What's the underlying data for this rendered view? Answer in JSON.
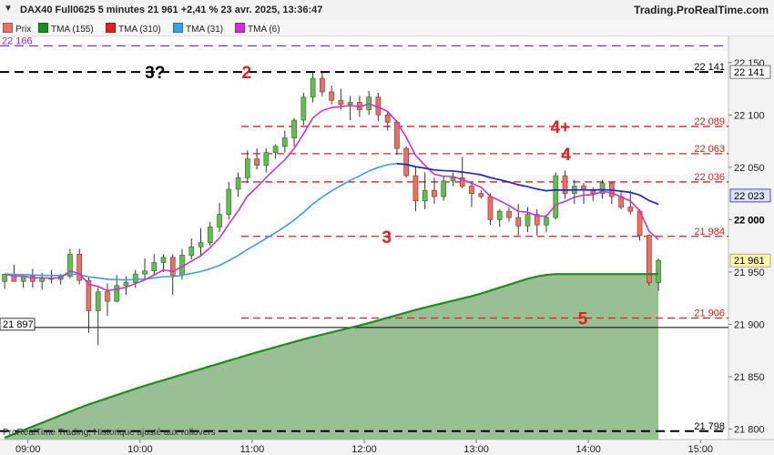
{
  "header": {
    "arrow_icon": "chevron-down",
    "title": "DAX40 Full0625 5 minutes 21 961 +2,41 % 23 avr. 2025, 13:36:47",
    "brand": "Trading.ProRealTime.com"
  },
  "legend": [
    {
      "label": "Prix",
      "color": "#e57366"
    },
    {
      "label": "TMA (155)",
      "color": "#1e8c1e"
    },
    {
      "label": "TMA (310)",
      "color": "#dd2020"
    },
    {
      "label": "TMA (31)",
      "color": "#3aa0e0"
    },
    {
      "label": "TMA (6)",
      "color": "#cc33cc"
    }
  ],
  "footer": "ProRealTime Trading, Historique ajusté aux rollovers",
  "chart_data": {
    "type": "candlestick",
    "y_range": [
      21790,
      22175
    ],
    "x_range": [
      "08:45",
      "15:15"
    ],
    "x_ticks": [
      "09:00",
      "10:00",
      "11:00",
      "12:00",
      "13:00",
      "14:00",
      "15:00"
    ],
    "y_ticks": [
      "22 150",
      "22 100",
      "22 050",
      "22 000",
      "21 950",
      "21 900",
      "21 850",
      "21 800"
    ],
    "colors": {
      "up": "#66bb55",
      "down": "#e57366",
      "up_border": "#2f7a25",
      "down_border": "#9a3a30",
      "tma155": "#1e8c1e",
      "tma31": "#3aa0e0",
      "tma6": "#cc33cc",
      "tma_blue": "#2222cc",
      "level": "#dd2020",
      "black_level": "#000000",
      "purple_level": "#8833cc",
      "area": "#8fb88a"
    },
    "candles": [
      [
        21941,
        21947,
        21934,
        21948
      ],
      [
        21948,
        21957,
        21941,
        21941
      ],
      [
        21941,
        21947,
        21935,
        21946
      ],
      [
        21946,
        21953,
        21935,
        21941
      ],
      [
        21941,
        21949,
        21933,
        21944
      ],
      [
        21944,
        21952,
        21939,
        21943
      ],
      [
        21943,
        21948,
        21938,
        21946
      ],
      [
        21946,
        21972,
        21944,
        21967
      ],
      [
        21967,
        21972,
        21938,
        21942
      ],
      [
        21942,
        21945,
        21892,
        21913
      ],
      [
        21913,
        21935,
        21880,
        21931
      ],
      [
        21931,
        21939,
        21908,
        21922
      ],
      [
        21922,
        21947,
        21921,
        21937
      ],
      [
        21937,
        21946,
        21928,
        21940
      ],
      [
        21940,
        21952,
        21935,
        21948
      ],
      [
        21948,
        21963,
        21942,
        21951
      ],
      [
        21951,
        21967,
        21947,
        21959
      ],
      [
        21959,
        21967,
        21950,
        21964
      ],
      [
        21964,
        21967,
        21928,
        21947
      ],
      [
        21947,
        21972,
        21943,
        21966
      ],
      [
        21966,
        21982,
        21962,
        21974
      ],
      [
        21974,
        21992,
        21966,
        21978
      ],
      [
        21978,
        21998,
        21975,
        21993
      ],
      [
        21993,
        22016,
        21988,
        22005
      ],
      [
        22005,
        22036,
        22000,
        22029
      ],
      [
        22029,
        22045,
        22022,
        22040
      ],
      [
        22040,
        22066,
        22035,
        22058
      ],
      [
        22058,
        22068,
        22048,
        22052
      ],
      [
        22052,
        22068,
        22045,
        22064
      ],
      [
        22064,
        22072,
        22058,
        22070
      ],
      [
        22070,
        22085,
        22064,
        22078
      ],
      [
        22078,
        22097,
        22070,
        22095
      ],
      [
        22095,
        22121,
        22090,
        22117
      ],
      [
        22117,
        22141,
        22112,
        22135
      ],
      [
        22135,
        22141,
        22118,
        22122
      ],
      [
        22122,
        22128,
        22110,
        22114
      ],
      [
        22114,
        22125,
        22105,
        22110
      ],
      [
        22110,
        22118,
        22095,
        22112
      ],
      [
        22112,
        22118,
        22098,
        22105
      ],
      [
        22105,
        22123,
        22100,
        22117
      ],
      [
        22117,
        22121,
        22094,
        22100
      ],
      [
        22100,
        22103,
        22085,
        22093
      ],
      [
        22093,
        22095,
        22062,
        22068
      ],
      [
        22068,
        22070,
        22040,
        22042
      ],
      [
        22042,
        22050,
        22008,
        22018
      ],
      [
        22018,
        22045,
        22010,
        22028
      ],
      [
        22028,
        22040,
        22015,
        22022
      ],
      [
        22022,
        22042,
        22018,
        22037
      ],
      [
        22037,
        22045,
        22032,
        22040
      ],
      [
        22040,
        22060,
        22030,
        22032
      ],
      [
        22032,
        22035,
        22012,
        22025
      ],
      [
        22025,
        22028,
        22020,
        22022
      ],
      [
        22022,
        22025,
        21995,
        22000
      ],
      [
        22000,
        22010,
        21993,
        22008
      ],
      [
        22008,
        22012,
        21998,
        22002
      ],
      [
        22002,
        22015,
        21985,
        21994
      ],
      [
        21994,
        22012,
        21988,
        22005
      ],
      [
        22005,
        22010,
        21985,
        21995
      ],
      [
        21995,
        22005,
        21988,
        22002
      ],
      [
        22002,
        22045,
        22000,
        22042
      ],
      [
        22042,
        22047,
        22020,
        22025
      ],
      [
        22025,
        22038,
        22015,
        22032
      ],
      [
        22032,
        22035,
        22015,
        22028
      ],
      [
        22028,
        22031,
        22018,
        22025
      ],
      [
        22025,
        22038,
        22020,
        22035
      ],
      [
        22035,
        22036,
        22015,
        22022
      ],
      [
        22022,
        22027,
        22010,
        22012
      ],
      [
        22012,
        22028,
        22005,
        22008
      ],
      [
        22008,
        22010,
        21980,
        21985
      ],
      [
        21985,
        21986,
        21937,
        21940
      ],
      [
        21940,
        21963,
        21932,
        21961
      ]
    ],
    "levels": [
      {
        "value": 22166,
        "label": "22 166",
        "style": "purple"
      },
      {
        "value": 22141,
        "label": "22 141",
        "style": "black"
      },
      {
        "value": 22089,
        "label": "22 089",
        "style": "red"
      },
      {
        "value": 22063,
        "label": "22 063",
        "style": "red"
      },
      {
        "value": 22036,
        "label": "22 036",
        "style": "red"
      },
      {
        "value": 21984,
        "label": "21 984",
        "style": "red"
      },
      {
        "value": 21906,
        "label": "21 906",
        "style": "red"
      },
      {
        "value": 21798,
        "label": "21 798",
        "style": "black"
      }
    ],
    "axis_markers": [
      {
        "value": 22141,
        "label": "22 141"
      },
      {
        "value": 22023,
        "label": "22 023"
      },
      {
        "value": 22000,
        "label": "22 000"
      },
      {
        "value": 21961,
        "label": "21 961"
      }
    ],
    "left_marker": {
      "value": 21897,
      "label": "21 897"
    },
    "annotations": [
      {
        "text": "3?",
        "color": "#000000",
        "x_time": "10:08",
        "value": 22141
      },
      {
        "text": "2",
        "color": "#dd2020",
        "x_time": "10:57",
        "value": 22141
      },
      {
        "text": "4+",
        "color": "#dd2020",
        "x_time": "13:45",
        "value": 22089
      },
      {
        "text": "4",
        "color": "#dd2020",
        "x_time": "13:48",
        "value": 22063
      },
      {
        "text": "3",
        "color": "#dd2020",
        "x_time": "12:12",
        "value": 21984
      },
      {
        "text": "5",
        "color": "#dd2020",
        "x_time": "13:57",
        "value": 21906
      }
    ]
  }
}
